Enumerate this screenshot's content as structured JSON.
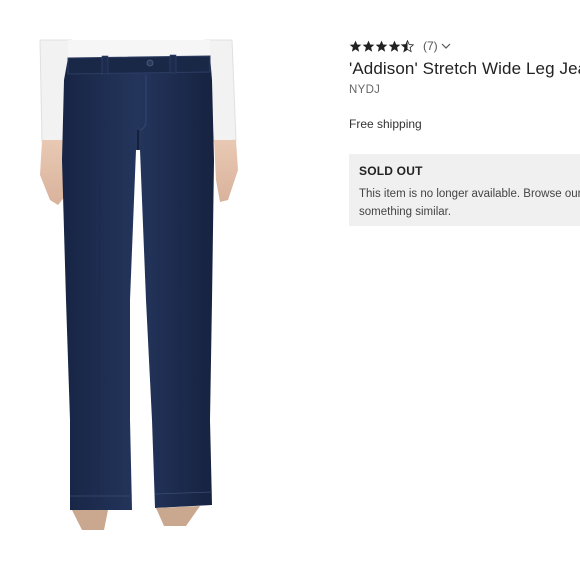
{
  "product": {
    "image_alt": "Dark wash wide leg jeans",
    "rating": {
      "stars_filled": 4.5,
      "stars_total": 5,
      "review_count": "(7)"
    },
    "title": "'Addison' Stretch Wide Leg Jea",
    "brand": "NYDJ",
    "shipping": "Free shipping"
  },
  "availability": {
    "heading": "SOLD OUT",
    "line1": "This item is no longer available. Browse our",
    "line2": "something similar."
  },
  "colors": {
    "denim": "#1e2d4f",
    "soldout_bg": "#f0f0f0",
    "star": "#222222"
  },
  "icons": {
    "star": "star-icon",
    "chevron": "chevron-down-icon"
  }
}
